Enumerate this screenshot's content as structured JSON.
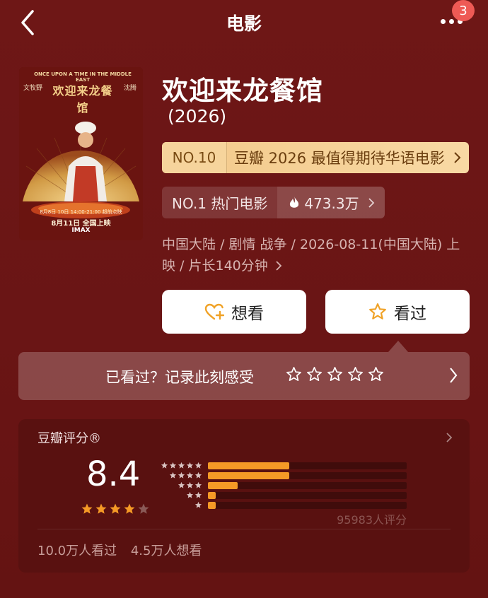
{
  "header": {
    "title": "电影",
    "badge": "3"
  },
  "movie": {
    "title": "欢迎来龙餐馆",
    "year": "(2026)",
    "poster": {
      "top_text": "ONCE UPON A TIME IN THE MIDDLE EAST",
      "title_text": "欢迎来龙餐馆",
      "actor_left": "文牧野",
      "actor_right": "沈腾",
      "preview": "8月8日 10日 14:00-21:00 超前点映",
      "release": "8月11日 全国上映",
      "format": "IMAX"
    }
  },
  "ranks": {
    "top_no": "NO.10",
    "top_text": "豆瓣 2026 最值得期待华语电影",
    "hot_no": "NO.1 热门电影",
    "heat": "473.3万"
  },
  "meta": {
    "info": "中国大陆 / 剧情 战争 / 2026-08-11(中国大陆) 上映 / 片长140分钟"
  },
  "actions": {
    "want": "想看",
    "seen": "看过"
  },
  "seen_prompt": {
    "text": "已看过？记录此刻感受"
  },
  "rating": {
    "label": "豆瓣评分®",
    "score": "8.4",
    "stars_filled": 4,
    "distribution": [
      0.41,
      0.41,
      0.15,
      0.04,
      0.04
    ],
    "votes": "95983人评分",
    "watched": "10.0万人看过",
    "wish": "4.5万人想看"
  },
  "colors": {
    "accent": "#f59a26",
    "background": "#6e1716",
    "card": "#591110",
    "badge": "#ee5a55"
  }
}
